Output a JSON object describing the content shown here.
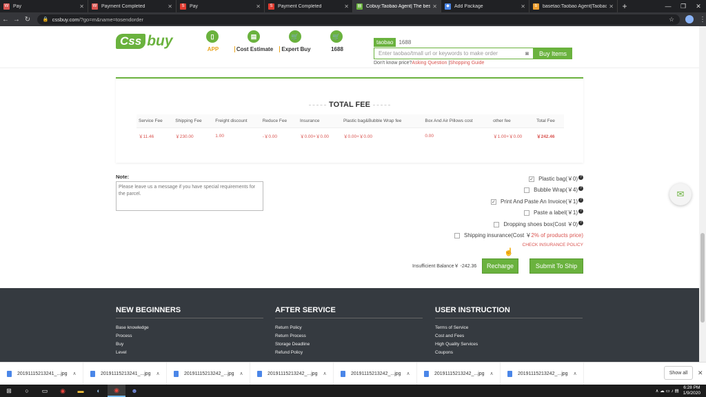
{
  "browser": {
    "tabs": [
      {
        "title": "Pay",
        "fav_color": "#d9534f",
        "fav_glyph": "W"
      },
      {
        "title": "Payment Completed",
        "fav_color": "#d9534f",
        "fav_glyph": "W"
      },
      {
        "title": "Pay",
        "fav_color": "#e03c31",
        "fav_glyph": "S"
      },
      {
        "title": "Payment Completed",
        "fav_color": "#e03c31",
        "fav_glyph": "S"
      },
      {
        "title": "Cobuy:Taobao Agent| The best c",
        "fav_color": "#6ab23e",
        "fav_glyph": "▤"
      },
      {
        "title": "Add Package",
        "fav_color": "#4a86e8",
        "fav_glyph": "◆"
      },
      {
        "title": "basetao:Taobao Agent|Taobao E",
        "fav_color": "#f0a030",
        "fav_glyph": "b"
      }
    ],
    "url_host": "cssbuy.com",
    "url_path": "/?go=m&name=tosendorder"
  },
  "header": {
    "logo_css": "Css",
    "logo_buy": "buy",
    "nav": [
      {
        "label": "APP",
        "icon": "phone-icon",
        "glyph": "▯"
      },
      {
        "label": "Cost Estimate",
        "icon": "document-icon",
        "glyph": "▤"
      },
      {
        "label": "Expert Buy",
        "icon": "cart-icon",
        "glyph": "🛒"
      },
      {
        "label": "1688",
        "icon": "cart-icon",
        "glyph": "🛒"
      }
    ],
    "search": {
      "tabs": [
        "taobao",
        "1688"
      ],
      "placeholder": "Enter taobao/tmall url or keywords to make order",
      "button": "Buy Items",
      "help_prefix": "Don't know price?",
      "help_link1": "Asking Question",
      "help_link2": "Shopping Guide"
    }
  },
  "total_fee": {
    "title": "TOTAL FEE",
    "headers": [
      "Service Fee",
      "Shipping Fee",
      "Freight discount",
      "Reduce Fee",
      "Insurance",
      "Plastic bag&Bubble Wrap fee",
      "Box And Air Pillows cost",
      "other fee",
      "Total Fee"
    ],
    "values": [
      "￥11.46",
      "￥230.00",
      "1.00",
      "-￥0.00",
      "￥0.00+￥0.00",
      "￥0.00+￥0.00",
      "0.00",
      "￥1.00+￥0.00",
      "￥242.46"
    ]
  },
  "note": {
    "label": "Note:",
    "placeholder": "Please leave us a message if you have special requirements for the parcel."
  },
  "options": [
    {
      "label": "Plastic bag(￥0)",
      "checked": true,
      "help": true
    },
    {
      "label": "Bubble Wrap(￥4)",
      "checked": false,
      "help": true
    },
    {
      "label": "Print And Paste An Invoice(￥1)",
      "checked": true,
      "help": true
    },
    {
      "label": "Paste a label(￥1)",
      "checked": false,
      "help": true
    },
    {
      "label": "Dropping shoes box(Cost ￥0)",
      "checked": false,
      "help": true
    }
  ],
  "shipping_insurance": {
    "label": "Shipping insurance(Cost ￥",
    "rate": "2% of products price",
    "close": ")",
    "policy_link": "CHECK INSURANCE POLICY"
  },
  "balance": {
    "label": "Insufficient Balance￥ -242.36"
  },
  "buttons": {
    "recharge": "Recharge",
    "submit": "Submit To Ship"
  },
  "footer": {
    "columns": [
      {
        "title": "NEW BEGINNERS",
        "links": [
          "Base knowledge",
          "Process",
          "Buy",
          "Level"
        ]
      },
      {
        "title": "AFTER SERVICE",
        "links": [
          "Return Policy",
          "Return Process",
          "Storage Deadline",
          "Refund Policy"
        ]
      },
      {
        "title": "USER INSTRUCTION",
        "links": [
          "Terms of Service",
          "Cost and Fees",
          "High Quality Services",
          "Coupons"
        ]
      }
    ]
  },
  "downloads": {
    "items": [
      "20191115213241_...jpg",
      "20191115213241_...jpg",
      "20191115213242_...jpg",
      "20191115213242_...jpg",
      "20191115213242_...jpg",
      "20191115213242_...jpg",
      "20191115213242_...jpg"
    ],
    "show_all": "Show all"
  },
  "taskbar": {
    "time": "6:28 PM",
    "date": "1/9/2020"
  }
}
